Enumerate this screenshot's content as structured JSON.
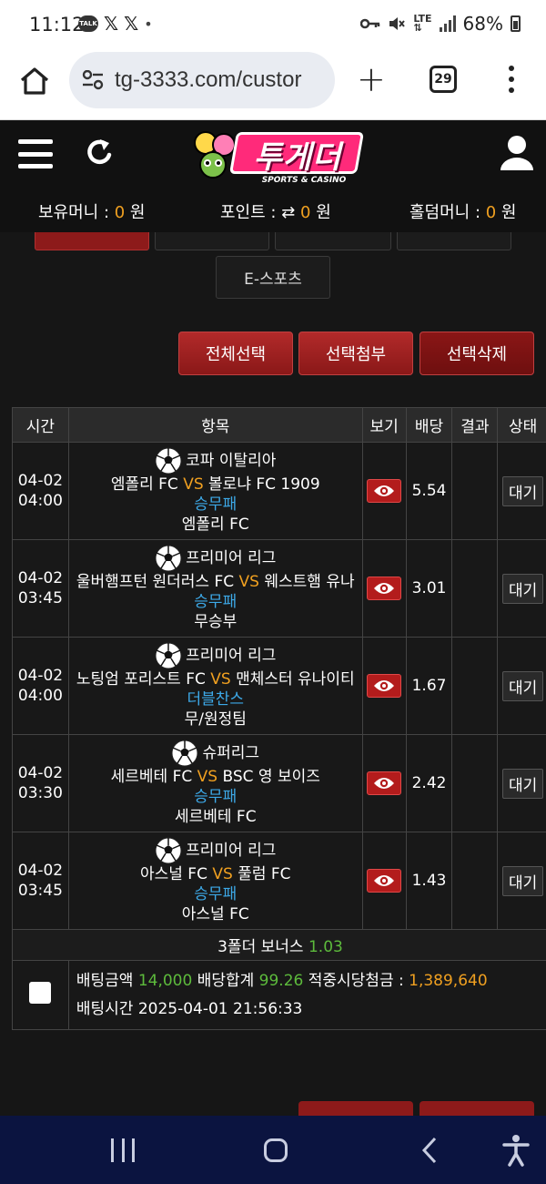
{
  "status_bar": {
    "time": "11:12",
    "battery": "68%",
    "notification_icons": [
      "kakaotalk-icon",
      "x-icon",
      "x-icon",
      "dot-icon"
    ],
    "system_icons": [
      "key-icon",
      "mute-icon",
      "lte-icon",
      "signal-icon",
      "battery-icon"
    ]
  },
  "browser": {
    "url": "tg-3333.com/custor",
    "tab_count": "29"
  },
  "header": {
    "logo_title": "투게더",
    "logo_sub": "SPORTS & CASINO",
    "balances": {
      "money_label": "보유머니 : ",
      "money_value": "0",
      "money_unit": " 원",
      "point_label": "포인트 : ",
      "point_value": "0",
      "point_unit": " 원",
      "holdem_label": "홀덤머니 : ",
      "holdem_value": "0",
      "holdem_unit": " 원"
    }
  },
  "categories": {
    "esports_label": "E-스포츠"
  },
  "actions": {
    "select_all": "전체선택",
    "attach_selected": "선택첨부",
    "delete_selected": "선택삭제"
  },
  "table": {
    "headers": [
      "시간",
      "항목",
      "보기",
      "배당",
      "결과",
      "상태"
    ],
    "rows": [
      {
        "date": "04-02",
        "time": "04:00",
        "league": "코파 이탈리아",
        "home": "엠폴리 FC",
        "vs": "VS",
        "away": "볼로냐 FC 1909",
        "market": "승무패",
        "pick": "엠폴리 FC",
        "odds": "5.54",
        "status": "대기"
      },
      {
        "date": "04-02",
        "time": "03:45",
        "league": "프리미어 리그",
        "home": "울버햄프턴 원더러스 FC",
        "vs": "VS",
        "away": "웨스트햄 유나",
        "market": "승무패",
        "pick": "무승부",
        "odds": "3.01",
        "status": "대기"
      },
      {
        "date": "04-02",
        "time": "04:00",
        "league": "프리미어 리그",
        "home": "노팅엄 포리스트 FC",
        "vs": "VS",
        "away": "맨체스터 유나이티",
        "market": "더블찬스",
        "pick": "무/원정팀",
        "odds": "1.67",
        "status": "대기"
      },
      {
        "date": "04-02",
        "time": "03:30",
        "league": "슈퍼리그",
        "home": "세르베테 FC",
        "vs": "VS",
        "away": "BSC 영 보이즈",
        "market": "승무패",
        "pick": "세르베테 FC",
        "odds": "2.42",
        "status": "대기"
      },
      {
        "date": "04-02",
        "time": "03:45",
        "league": "프리미어 리그",
        "home": "아스널 FC",
        "vs": "VS",
        "away": "풀럼 FC",
        "market": "승무패",
        "pick": "아스널 FC",
        "odds": "1.43",
        "status": "대기"
      }
    ],
    "bonus_label": "3폴더 보너스 ",
    "bonus_value": "1.03",
    "summary": {
      "amount_label": "배팅금액 ",
      "amount_value": "14,000",
      "total_odds_label": " 배당합계 ",
      "total_odds_value": "99.26",
      "payout_label": " 적중시당첨금 : ",
      "payout_value": "1,389,640",
      "time_label": "배팅시간 ",
      "time_value": "2025-04-01 21:56:33"
    }
  },
  "colors": {
    "accent_red": "#8d1a1a",
    "odds_green": "#5dbb3c",
    "highlight_orange": "#f0a020",
    "market_blue": "#3da9e8",
    "logo_pink": "#ff2a7a",
    "nav_bar": "#0b1440"
  }
}
